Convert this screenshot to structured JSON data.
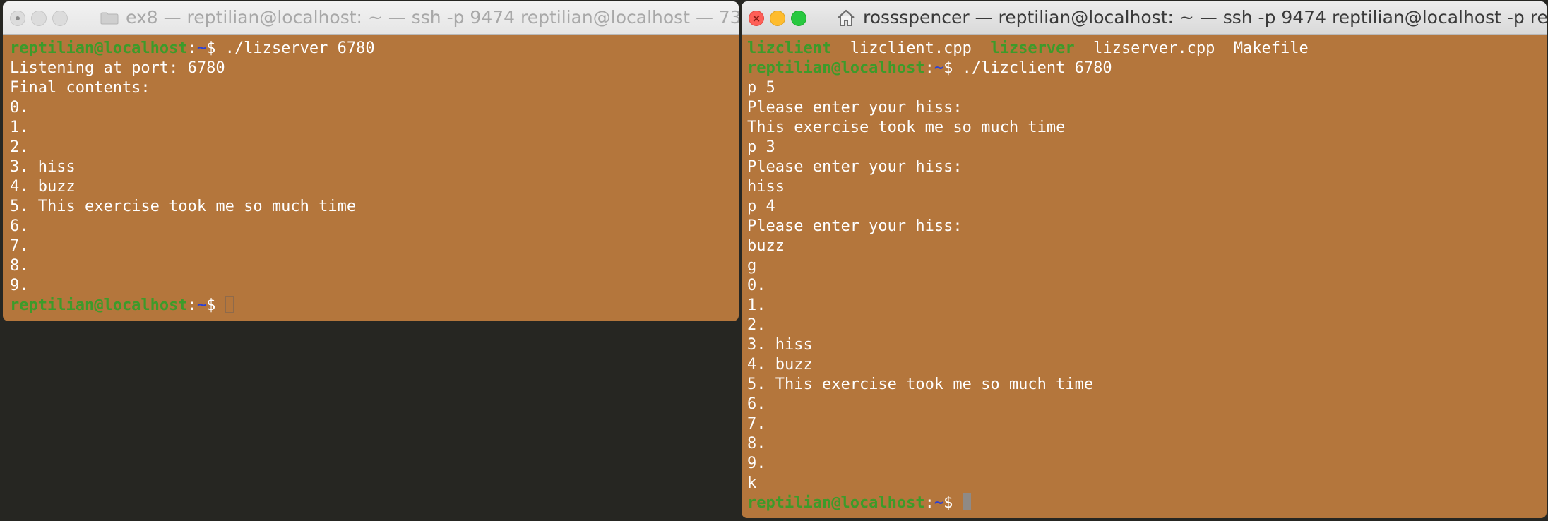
{
  "left_window": {
    "title": "ex8 — reptilian@localhost: ~ — ssh -p 9474 reptilian@localhost — 73...",
    "icon": "folder-icon",
    "lines": [
      {
        "type": "prompt",
        "user": "reptilian@localhost",
        "colon": ":",
        "tilde": "~",
        "dollar": "$ ",
        "cmd": "./lizserver 6780"
      },
      {
        "type": "text",
        "text": "Listening at port: 6780"
      },
      {
        "type": "text",
        "text": "Final contents:"
      },
      {
        "type": "text",
        "text": "0."
      },
      {
        "type": "text",
        "text": "1."
      },
      {
        "type": "text",
        "text": "2."
      },
      {
        "type": "text",
        "text": "3. hiss"
      },
      {
        "type": "text",
        "text": "4. buzz"
      },
      {
        "type": "text",
        "text": "5. This exercise took me so much time"
      },
      {
        "type": "text",
        "text": "6."
      },
      {
        "type": "text",
        "text": "7."
      },
      {
        "type": "text",
        "text": "8."
      },
      {
        "type": "text",
        "text": "9."
      },
      {
        "type": "prompt",
        "user": "reptilian@localhost",
        "colon": ":",
        "tilde": "~",
        "dollar": "$ ",
        "cmd": "",
        "cursor": "hollow"
      }
    ]
  },
  "right_window": {
    "title": "rossspencer — reptilian@localhost: ~ — ssh -p 9474 reptilian@localhost -p re...",
    "icon": "house-icon",
    "lines": [
      {
        "type": "ls",
        "items": [
          {
            "name": "lizclient",
            "exec": true
          },
          {
            "name": "lizclient.cpp",
            "exec": false
          },
          {
            "name": "lizserver",
            "exec": true
          },
          {
            "name": "lizserver.cpp",
            "exec": false
          },
          {
            "name": "Makefile",
            "exec": false
          }
        ]
      },
      {
        "type": "prompt",
        "user": "reptilian@localhost",
        "colon": ":",
        "tilde": "~",
        "dollar": "$ ",
        "cmd": "./lizclient 6780"
      },
      {
        "type": "text",
        "text": "p 5"
      },
      {
        "type": "text",
        "text": "Please enter your hiss:"
      },
      {
        "type": "text",
        "text": "This exercise took me so much time"
      },
      {
        "type": "text",
        "text": "p 3"
      },
      {
        "type": "text",
        "text": "Please enter your hiss:"
      },
      {
        "type": "text",
        "text": "hiss"
      },
      {
        "type": "text",
        "text": "p 4"
      },
      {
        "type": "text",
        "text": "Please enter your hiss:"
      },
      {
        "type": "text",
        "text": "buzz"
      },
      {
        "type": "text",
        "text": "g"
      },
      {
        "type": "text",
        "text": "0."
      },
      {
        "type": "text",
        "text": "1."
      },
      {
        "type": "text",
        "text": "2."
      },
      {
        "type": "text",
        "text": "3. hiss"
      },
      {
        "type": "text",
        "text": "4. buzz"
      },
      {
        "type": "text",
        "text": "5. This exercise took me so much time"
      },
      {
        "type": "text",
        "text": "6."
      },
      {
        "type": "text",
        "text": "7."
      },
      {
        "type": "text",
        "text": "8."
      },
      {
        "type": "text",
        "text": "9."
      },
      {
        "type": "text",
        "text": "k"
      },
      {
        "type": "prompt",
        "user": "reptilian@localhost",
        "colon": ":",
        "tilde": "~",
        "dollar": "$ ",
        "cmd": "",
        "cursor": "solid"
      }
    ]
  },
  "colors": {
    "terminal_bg": "#b4763c",
    "prompt_user": "#3d9b2a",
    "prompt_tilde": "#2b41d6",
    "desktop_bg": "#262622"
  }
}
